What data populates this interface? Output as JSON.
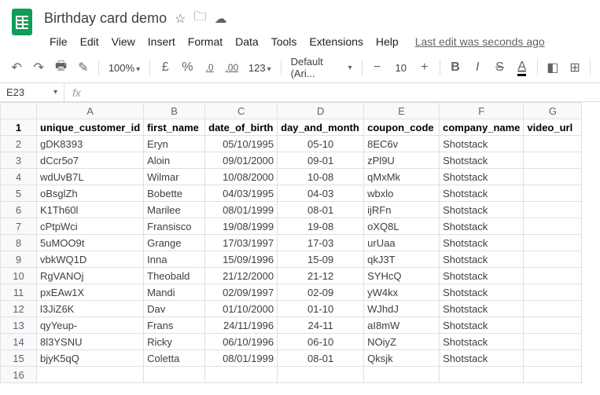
{
  "doc": {
    "title": "Birthday card demo",
    "lastEdit": "Last edit was seconds ago"
  },
  "menu": [
    "File",
    "Edit",
    "View",
    "Insert",
    "Format",
    "Data",
    "Tools",
    "Extensions",
    "Help"
  ],
  "toolbar": {
    "zoom": "100%",
    "currency": "£",
    "percent": "%",
    "decDec": ".0",
    "incDec": ".00",
    "moreFmt": "123",
    "font": "Default (Ari...",
    "size": "10",
    "bold": "B",
    "italic": "I",
    "strike": "S",
    "textColor": "A"
  },
  "nameBox": "E23",
  "columns": [
    "A",
    "B",
    "C",
    "D",
    "E",
    "F",
    "G"
  ],
  "headers": [
    "unique_customer_id",
    "first_name",
    "date_of_birth",
    "day_and_month",
    "coupon_code",
    "company_name",
    "video_url"
  ],
  "rows": [
    [
      "gDK8393",
      "Eryn",
      "05/10/1995",
      "05-10",
      "8EC6v",
      "Shotstack",
      ""
    ],
    [
      "dCcr5o7",
      "Aloin",
      "09/01/2000",
      "09-01",
      "zPl9U",
      "Shotstack",
      ""
    ],
    [
      "wdUvB7L",
      "Wilmar",
      "10/08/2000",
      "10-08",
      "qMxMk",
      "Shotstack",
      ""
    ],
    [
      "oBsglZh",
      "Bobette",
      "04/03/1995",
      "04-03",
      "wbxlo",
      "Shotstack",
      ""
    ],
    [
      "K1Th60l",
      "Marilee",
      "08/01/1999",
      "08-01",
      "ijRFn",
      "Shotstack",
      ""
    ],
    [
      "cPtpWci",
      "Fransisco",
      "19/08/1999",
      "19-08",
      "oXQ8L",
      "Shotstack",
      ""
    ],
    [
      "5uMOO9t",
      "Grange",
      "17/03/1997",
      "17-03",
      "urUaa",
      "Shotstack",
      ""
    ],
    [
      "vbkWQ1D",
      "Inna",
      "15/09/1996",
      "15-09",
      "qkJ3T",
      "Shotstack",
      ""
    ],
    [
      "RgVANOj",
      "Theobald",
      "21/12/2000",
      "21-12",
      "SYHcQ",
      "Shotstack",
      ""
    ],
    [
      "pxEAw1X",
      "Mandi",
      "02/09/1997",
      "02-09",
      "yW4kx",
      "Shotstack",
      ""
    ],
    [
      "l3JiZ6K",
      "Dav",
      "01/10/2000",
      "01-10",
      "WJhdJ",
      "Shotstack",
      ""
    ],
    [
      "qyYeup-",
      "Frans",
      "24/11/1996",
      "24-11",
      "aI8mW",
      "Shotstack",
      ""
    ],
    [
      "8l3YSNU",
      "Ricky",
      "06/10/1996",
      "06-10",
      "NOiyZ",
      "Shotstack",
      ""
    ],
    [
      "bjyK5qQ",
      "Coletta",
      "08/01/1999",
      "08-01",
      "Qksjk",
      "Shotstack",
      ""
    ]
  ]
}
